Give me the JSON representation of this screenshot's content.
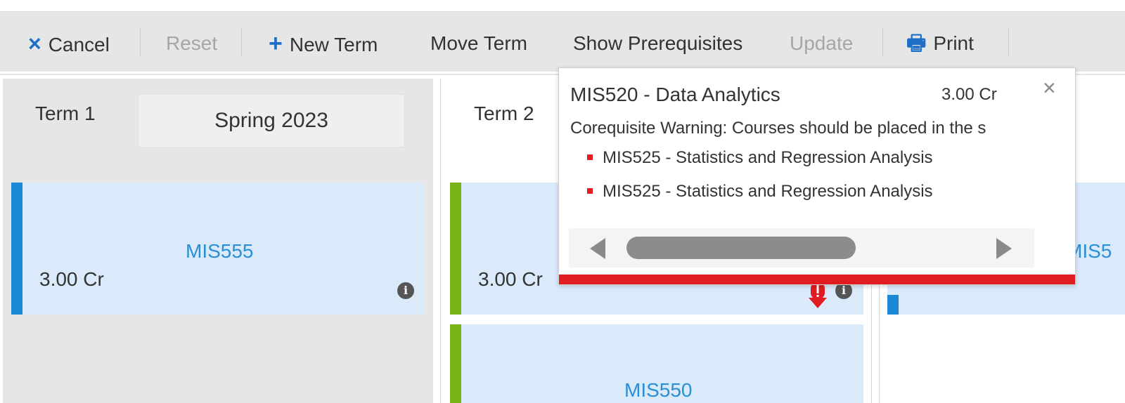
{
  "toolbar": {
    "cancel_label": "Cancel",
    "cancel_icon": "×",
    "reset_label": "Reset",
    "new_term_label": "New Term",
    "new_term_icon": "+",
    "move_term_label": "Move Term",
    "show_prereq_label": "Show Prerequisites",
    "update_label": "Update",
    "print_label": "Print",
    "print_icon": "🖶"
  },
  "terms": [
    {
      "label": "Term 1",
      "name": "Spring 2023",
      "courses": [
        {
          "code": "MIS555",
          "credits": "3.00 Cr",
          "bar_color": "#1a8ad8",
          "info_icon": "i"
        }
      ]
    },
    {
      "label": "Term 2",
      "courses": [
        {
          "code": "",
          "credits": "3.00 Cr",
          "bar_color": "#7ab317",
          "info_icon": "i"
        },
        {
          "code": "MIS550",
          "credits": "",
          "bar_color": "#7ab317"
        }
      ]
    },
    {
      "courses": [
        {
          "code": "MIS5",
          "bar_color": "#1a8ad8"
        }
      ]
    }
  ],
  "popover": {
    "title": "MIS520 - Data Analytics",
    "credits": "3.00 Cr",
    "close_icon": "×",
    "warning": "Corequisite Warning: Courses should be placed in the s",
    "items": [
      "MIS525 - Statistics and Regression Analysis",
      "MIS525 - Statistics and Regression Analysis"
    ],
    "accent_color": "#e01b22"
  }
}
